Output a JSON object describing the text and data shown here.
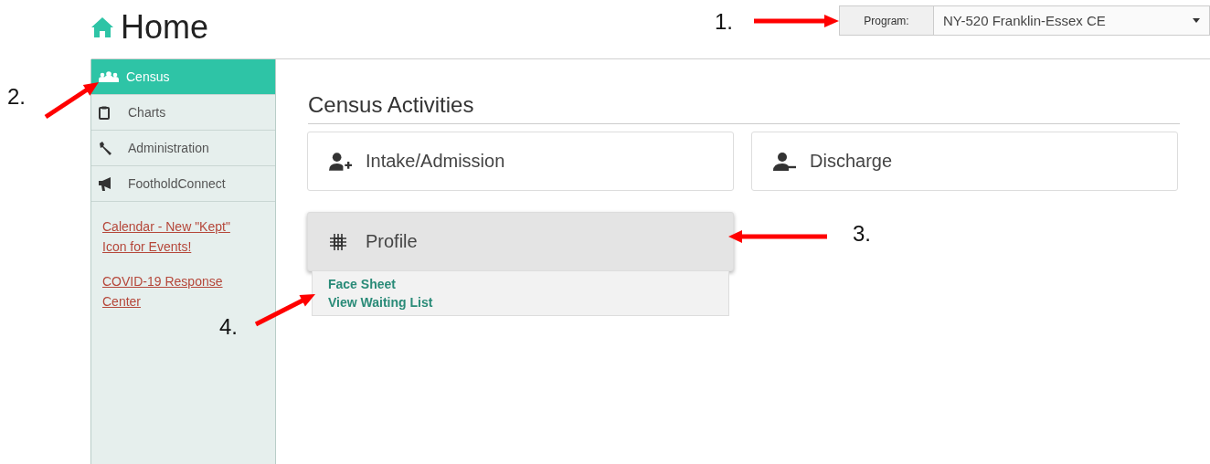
{
  "page": {
    "title": "Home"
  },
  "program_selector": {
    "label": "Program:",
    "value": "NY-520 Franklin-Essex CE"
  },
  "sidebar": {
    "items": [
      {
        "label": "Census",
        "kind": "people",
        "selected": true
      },
      {
        "label": "Charts",
        "kind": "clipboard",
        "selected": false
      },
      {
        "label": "Administration",
        "kind": "wrench",
        "selected": false
      },
      {
        "label": "FootholdConnect",
        "kind": "megaphone",
        "selected": false
      }
    ],
    "links": [
      "Calendar - New \"Kept\" Icon for Events!",
      "COVID-19 Response Center"
    ]
  },
  "section": {
    "title": "Census Activities",
    "cards": [
      {
        "label": "Intake/Admission",
        "kind": "user-plus",
        "expanded": false
      },
      {
        "label": "Discharge",
        "kind": "user-minus",
        "expanded": false
      },
      {
        "label": "Profile",
        "kind": "grid",
        "expanded": true,
        "menu": [
          "Face Sheet",
          "View Waiting List"
        ]
      }
    ]
  },
  "annotations": [
    {
      "label": "1."
    },
    {
      "label": "2."
    },
    {
      "label": "3."
    },
    {
      "label": "4."
    }
  ]
}
